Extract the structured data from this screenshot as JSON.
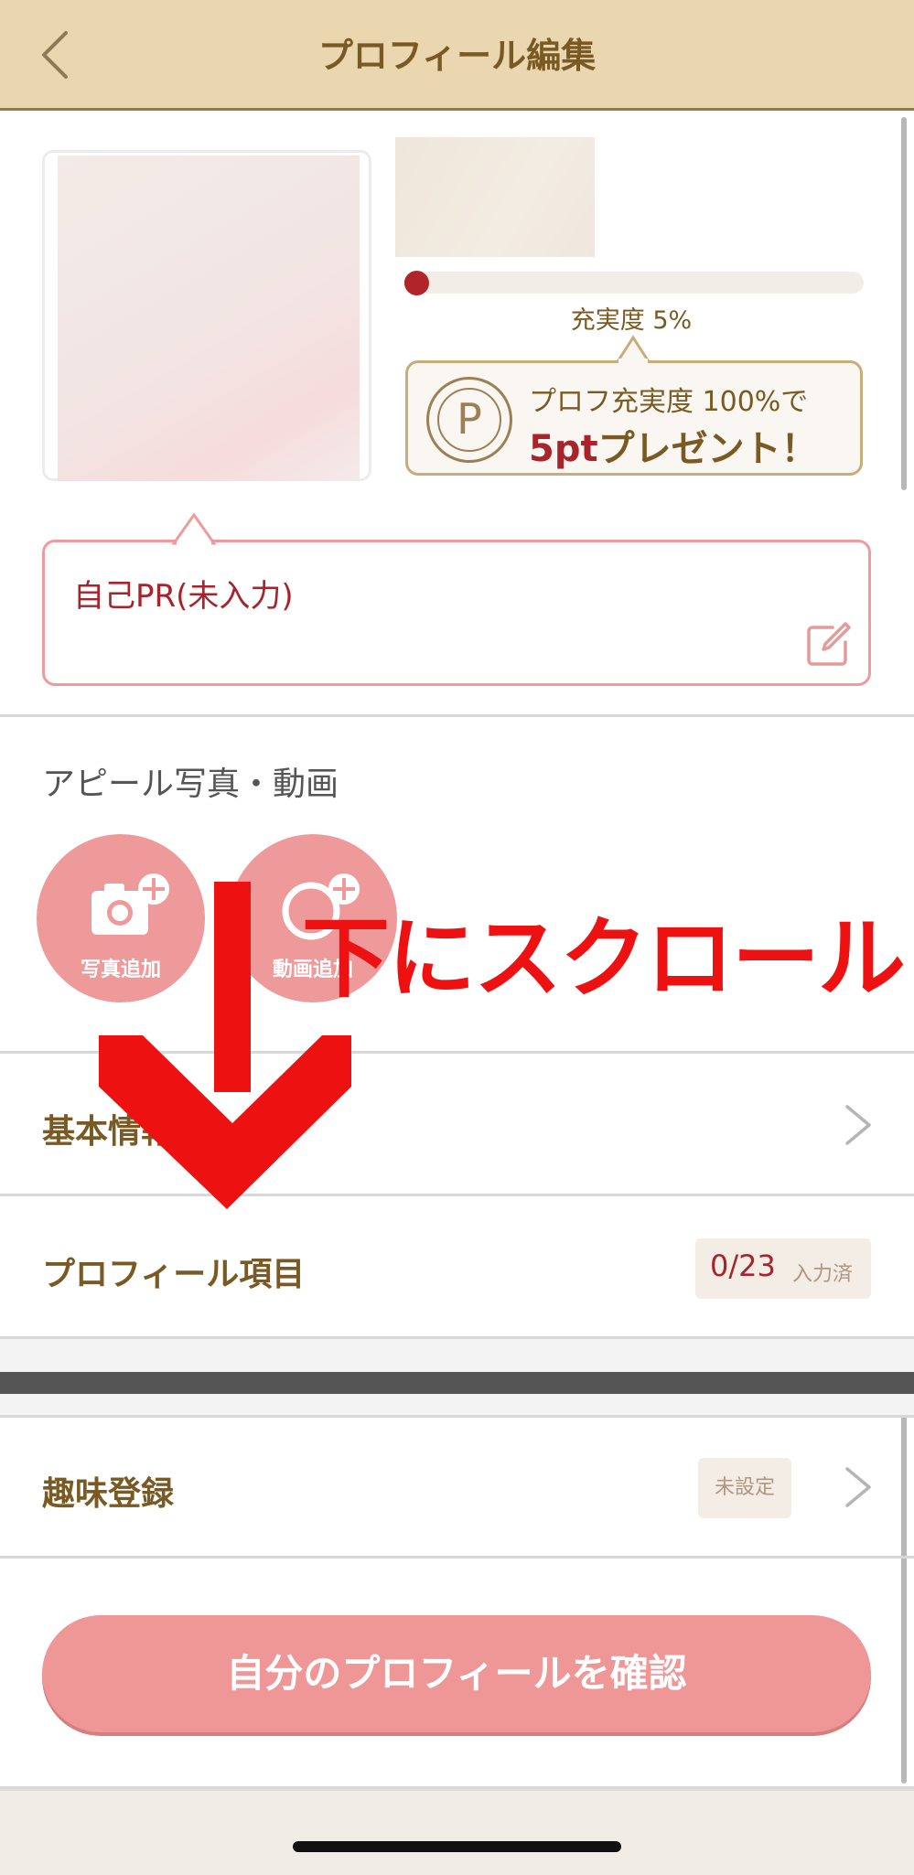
{
  "header": {
    "title": "プロフィール編集"
  },
  "profile": {
    "completion_text": "充実度 5%",
    "completion_percent": 5,
    "reward_line1": "プロフ充実度 100%で",
    "reward_points": "5pt",
    "reward_rest": "プレゼント！",
    "coin_symbol": "P"
  },
  "pr": {
    "text": "自己PR(未入力)"
  },
  "appeal": {
    "label": "アピール写真・動画",
    "photo_add": "写真追加",
    "video_add": "動画追加"
  },
  "rows": {
    "basic_info": "基本情報",
    "profile_items": "プロフィール項目",
    "profile_items_count": "0/23",
    "profile_items_count_suffix": "入力済",
    "hobby": "趣味登録",
    "hobby_status": "未設定"
  },
  "confirm_button": "自分のプロフィールを確認",
  "overlay": {
    "scroll_hint": "下にスクロール"
  },
  "colors": {
    "header_bg": "#ead7b0",
    "accent_red": "#a8232b",
    "accent_pink": "#ef9a9a",
    "brown_text": "#7a5a24",
    "overlay_red": "#ee1111"
  }
}
